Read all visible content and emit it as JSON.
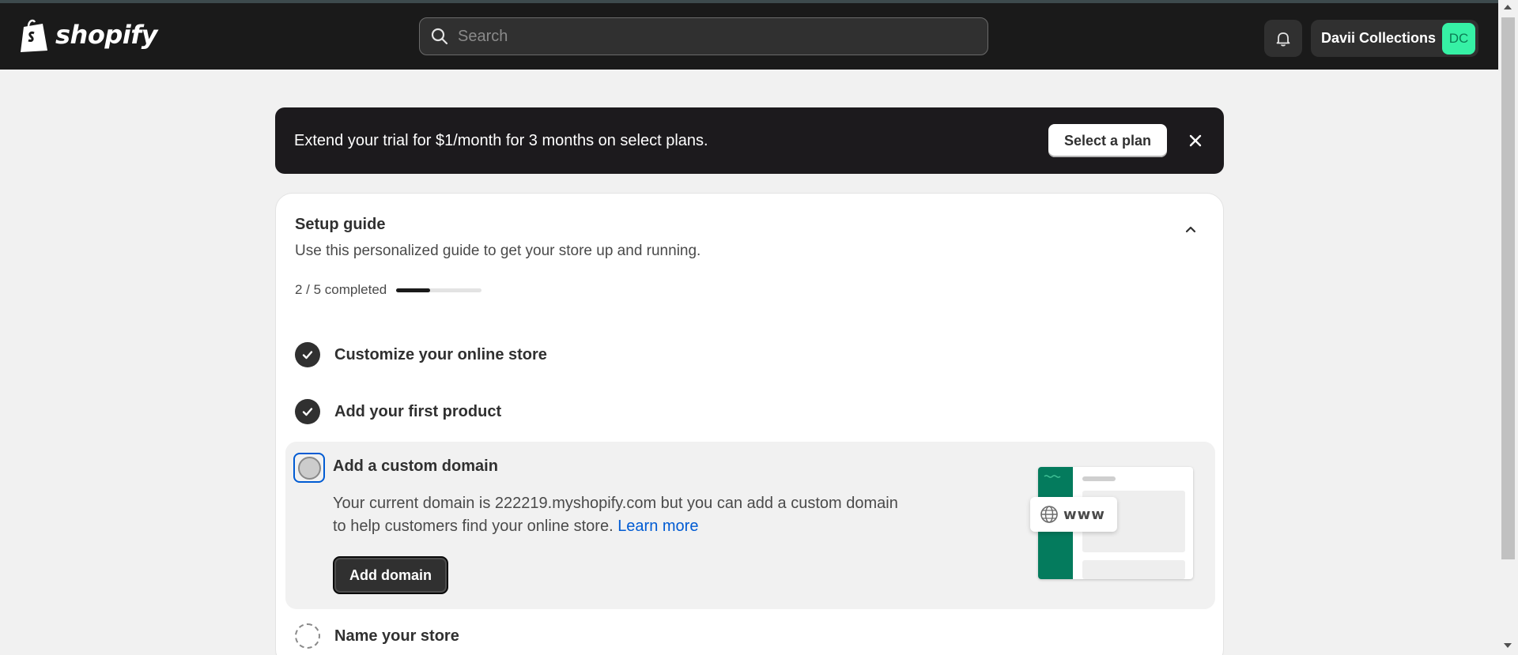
{
  "header": {
    "logo_text": "shopify",
    "search_placeholder": "Search",
    "store_name": "Davii Collections",
    "avatar_initials": "DC"
  },
  "banner": {
    "text": "Extend your trial for $1/month for 3 months on select plans.",
    "cta_label": "Select a plan"
  },
  "setup_guide": {
    "title": "Setup guide",
    "subtitle": "Use this personalized guide to get your store up and running.",
    "progress_text": "2 / 5 completed",
    "progress_fraction": 0.4,
    "tasks": [
      {
        "label": "Customize your online store",
        "status": "completed"
      },
      {
        "label": "Add your first product",
        "status": "completed"
      },
      {
        "label": "Add a custom domain",
        "status": "active",
        "description": "Your current domain is 222219.myshopify.com but you can add a custom domain to help customers find your online store.",
        "link_label": "Learn more",
        "button_label": "Add domain",
        "illustration_text": "www"
      },
      {
        "label": "Name your store",
        "status": "pending"
      }
    ]
  },
  "colors": {
    "topbar_bg": "#1a1a1a",
    "accent_link": "#005bd3",
    "avatar_bg": "#36f1a5",
    "illustration_green": "#047b5d"
  }
}
